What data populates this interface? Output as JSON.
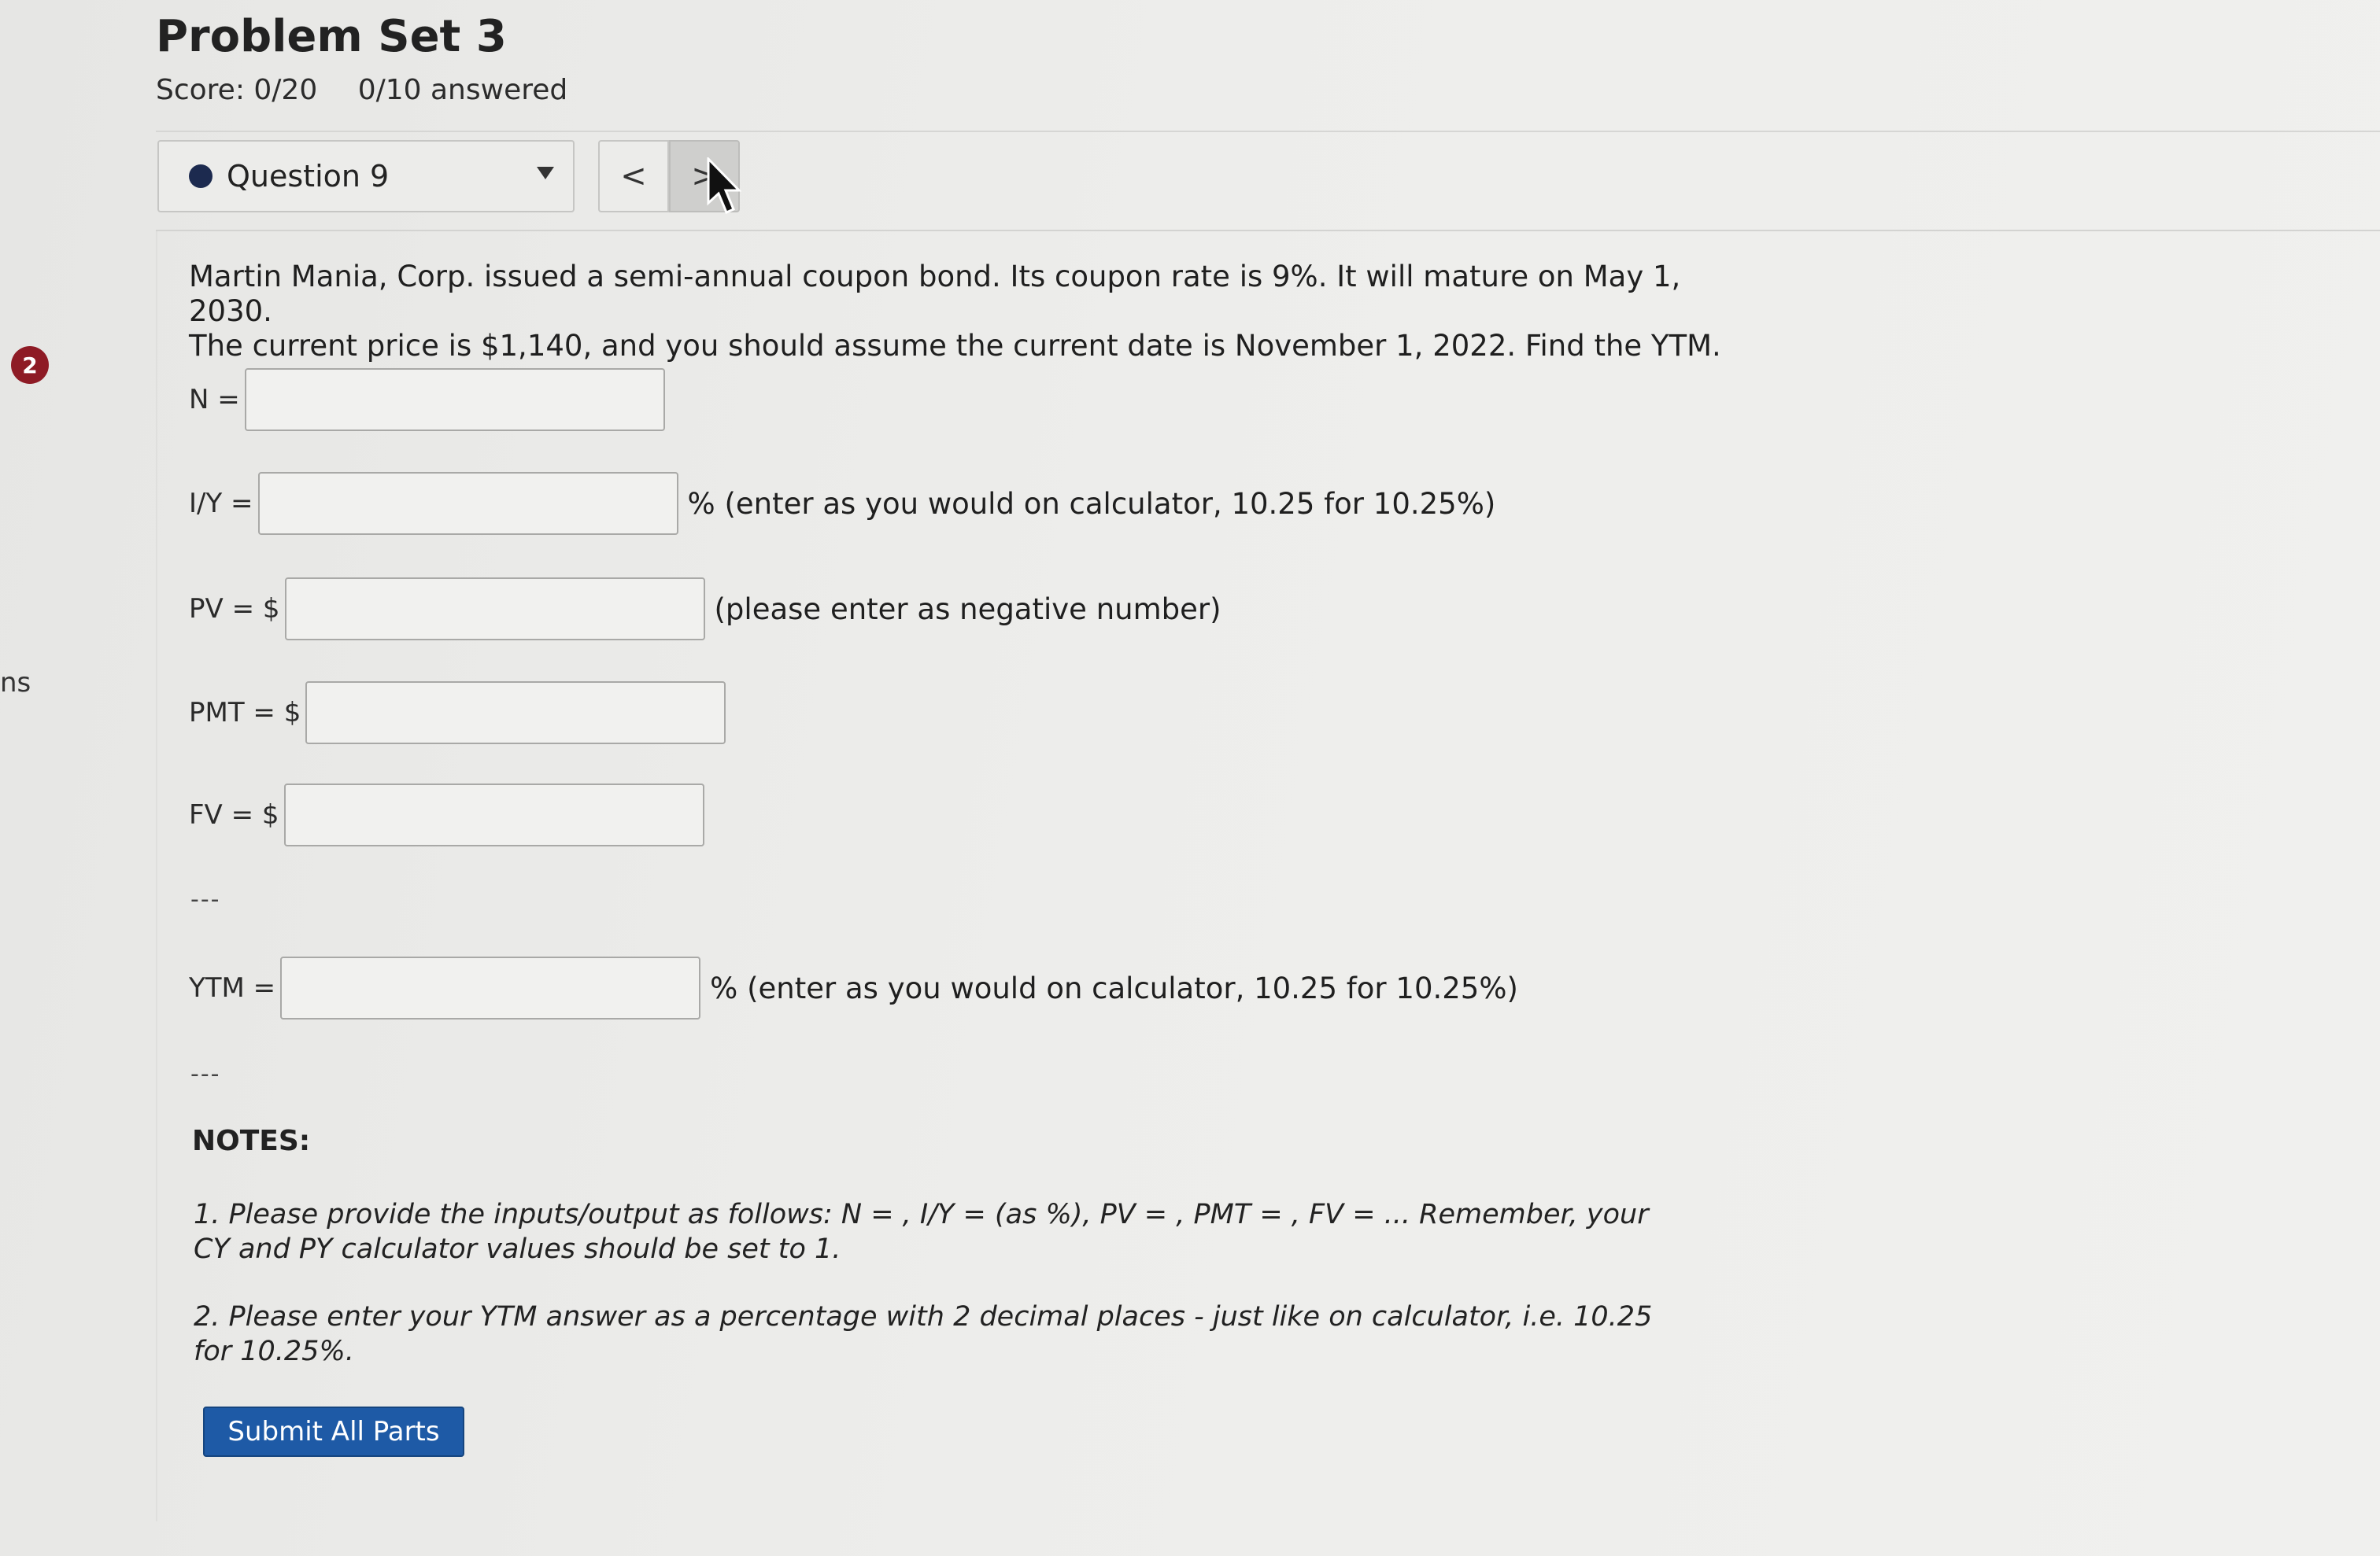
{
  "page": {
    "title": "Problem Set 3",
    "score": "Score: 0/20",
    "answered": "0/10 answered",
    "side_badge": "2",
    "side_edge_text": "ns"
  },
  "question_nav": {
    "selected_question": "Question 9",
    "prev_label": "<",
    "next_label": ">"
  },
  "problem": {
    "line1": "Martin Mania, Corp. issued a semi-annual coupon bond. Its coupon rate is 9%. It will mature on May 1, 2030.",
    "line2": "The current price is $1,140, and you should assume the current date is November 1, 2022. Find the YTM."
  },
  "fields": {
    "n": {
      "label": "N =",
      "value": "",
      "hint": ""
    },
    "iy": {
      "label": "I/Y =",
      "value": "",
      "hint": "% (enter as you would on calculator, 10.25 for 10.25%)"
    },
    "pv": {
      "label": "PV = $",
      "value": "",
      "hint": "(please enter as negative number)"
    },
    "pmt": {
      "label": "PMT = $",
      "value": "",
      "hint": ""
    },
    "fv": {
      "label": "FV = $",
      "value": "",
      "hint": ""
    },
    "ytm": {
      "label": "YTM =",
      "value": "",
      "hint": "% (enter as you would on calculator, 10.25 for 10.25%)"
    }
  },
  "separator": "---",
  "notes": {
    "heading": "NOTES:",
    "note1_line1": "1. Please provide the inputs/output as follows: N = , I/Y = (as %), PV = , PMT = , FV = ... Remember, your",
    "note1_line2": "CY and PY calculator values should be set to 1.",
    "note2_line1": "2. Please enter your YTM answer as a percentage with 2 decimal places - just like on calculator, i.e. 10.25",
    "note2_line2": "for 10.25%."
  },
  "submit_label": "Submit All Parts",
  "colors": {
    "submit_button": "#1e5aa6",
    "question_dot": "#1c2a4f",
    "side_badge": "#8e1b25"
  }
}
